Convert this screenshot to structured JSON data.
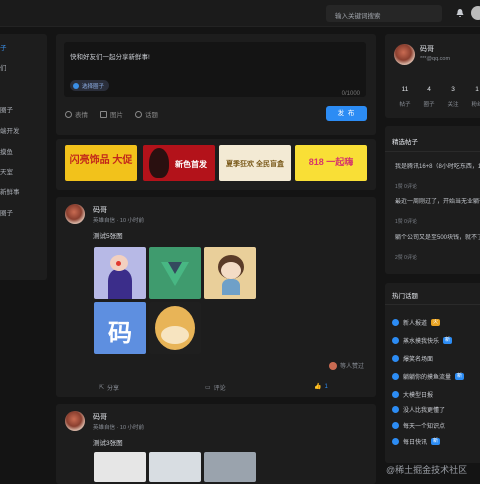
{
  "topbar": {
    "search_placeholder": "输入关键词搜索",
    "bell_icon": "bell-icon"
  },
  "sidebar": {
    "items": [
      {
        "label": "子",
        "active": true
      },
      {
        "label": "们"
      },
      {
        "label": ""
      },
      {
        "label": "圈子"
      },
      {
        "label": "端开发"
      },
      {
        "label": ""
      },
      {
        "label": "摸鱼"
      },
      {
        "label": "天室"
      },
      {
        "label": "新鲜事"
      },
      {
        "label": ""
      },
      {
        "label": "圈子"
      }
    ]
  },
  "composer": {
    "placeholder": "快和好友们一起分享新鲜事!",
    "circle_button": "选择圈子",
    "counter": "0/1000",
    "tools": [
      "表情",
      "图片",
      "话题"
    ],
    "send_label": "发 布"
  },
  "banners": [
    {
      "text": "闪亮饰品 大促",
      "bg": "#f2c21b"
    },
    {
      "text": "新色首发",
      "bg": "#b3121a"
    },
    {
      "text": "夏季狂欢 全民盲盒",
      "bg": "#f3ead4"
    },
    {
      "text": "818 一起嗨",
      "bg": "#f9df36"
    }
  ],
  "posts": [
    {
      "name": "码哥",
      "meta": "英雄自信 · 10 小时前",
      "title": "测试5张图",
      "images": [
        "cartoon-figure",
        "vue-logo",
        "cartoon-girl",
        "码",
        "doge"
      ],
      "liked_by": "等人赞过",
      "share": "分享",
      "comment": "评论",
      "likes": "1"
    },
    {
      "name": "码哥",
      "meta": "英雄自信 · 10 小时前",
      "title": "测试3张图"
    }
  ],
  "profile": {
    "name": "码哥",
    "email": "***@qq.com",
    "stats": [
      {
        "n": "11",
        "l": "帖子"
      },
      {
        "n": "4",
        "l": "圈子"
      },
      {
        "n": "3",
        "l": "关注"
      },
      {
        "n": "1",
        "l": "粉丝"
      }
    ]
  },
  "hot_posts": {
    "title": "精选帖子",
    "items": [
      {
        "text": "我是腾讯16+8（8小时吃东西，16小时不吃东西），就是是腾讯…",
        "meta": "1赞 0评论"
      },
      {
        "text": "最近一周刚过了，开始当无业躺平我了!",
        "meta": "1赞 0评论"
      },
      {
        "text": "躺个公司又是至500块钱，就不了，换成躯子吗 没一亦新塞",
        "meta": "2赞 0评论"
      }
    ]
  },
  "topics": {
    "title": "热门话题",
    "items": [
      {
        "label": "新人报道",
        "tag": "火",
        "tag_color": "#e8a323"
      },
      {
        "label": "蒸水摸我快乐",
        "tag": "新",
        "tag_color": "#2c8cf4"
      },
      {
        "label": "爆笑名场面",
        "tag": "",
        "tag_color": ""
      },
      {
        "label": "躺躺你的摸鱼流量",
        "tag": "新",
        "tag_color": "#2c8cf4"
      },
      {
        "label": "大模型日报",
        "tag": "",
        "tag_color": ""
      },
      {
        "label": "没人比我更懂了",
        "tag": "",
        "tag_color": ""
      },
      {
        "label": "每天一个知识点",
        "tag": "",
        "tag_color": ""
      },
      {
        "label": "每日快讯",
        "tag": "新",
        "tag_color": "#2c8cf4"
      }
    ]
  },
  "watermark": "@稀土掘金技术社区"
}
